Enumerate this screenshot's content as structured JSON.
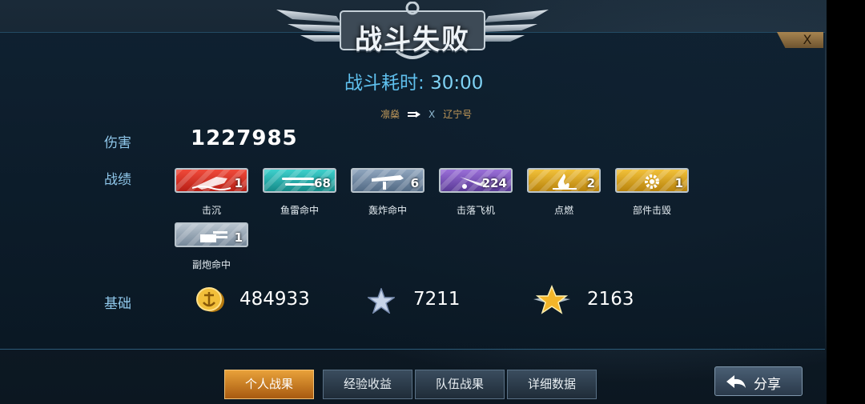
{
  "header": {
    "title": "战斗失败",
    "duration_label": "战斗耗时:",
    "duration_value": "30:00",
    "close_label": "X"
  },
  "matchup": {
    "player_ship": "凛燊",
    "vs": "X",
    "enemy_ship": "辽宁号"
  },
  "damage": {
    "label": "伤害",
    "value": "1227985"
  },
  "record": {
    "label": "战绩",
    "medals": [
      {
        "label": "击沉",
        "count": "1",
        "color": "#d8332a",
        "icon": "ship-sink-icon"
      },
      {
        "label": "鱼雷命中",
        "count": "68",
        "color": "#2fb3b0",
        "icon": "torpedo-icon"
      },
      {
        "label": "轰炸命中",
        "count": "6",
        "color": "#6f86a0",
        "icon": "bomb-icon"
      },
      {
        "label": "击落飞机",
        "count": "224",
        "color": "#7a55b8",
        "icon": "plane-shot-icon"
      },
      {
        "label": "点燃",
        "count": "2",
        "color": "#d9a21c",
        "icon": "fire-icon"
      },
      {
        "label": "部件击毁",
        "count": "1",
        "color": "#d9a21c",
        "icon": "gear-icon"
      },
      {
        "label": "副炮命中",
        "count": "1",
        "color": "#9aa9b8",
        "icon": "secondary-gun-icon"
      }
    ]
  },
  "base": {
    "label": "基础",
    "coins": "484933",
    "exp": "7211",
    "rank": "2163"
  },
  "tabs": [
    {
      "label": "个人战果",
      "active": true
    },
    {
      "label": "经验收益",
      "active": false
    },
    {
      "label": "队伍战果",
      "active": false
    },
    {
      "label": "详细数据",
      "active": false
    }
  ],
  "share_label": "分享"
}
